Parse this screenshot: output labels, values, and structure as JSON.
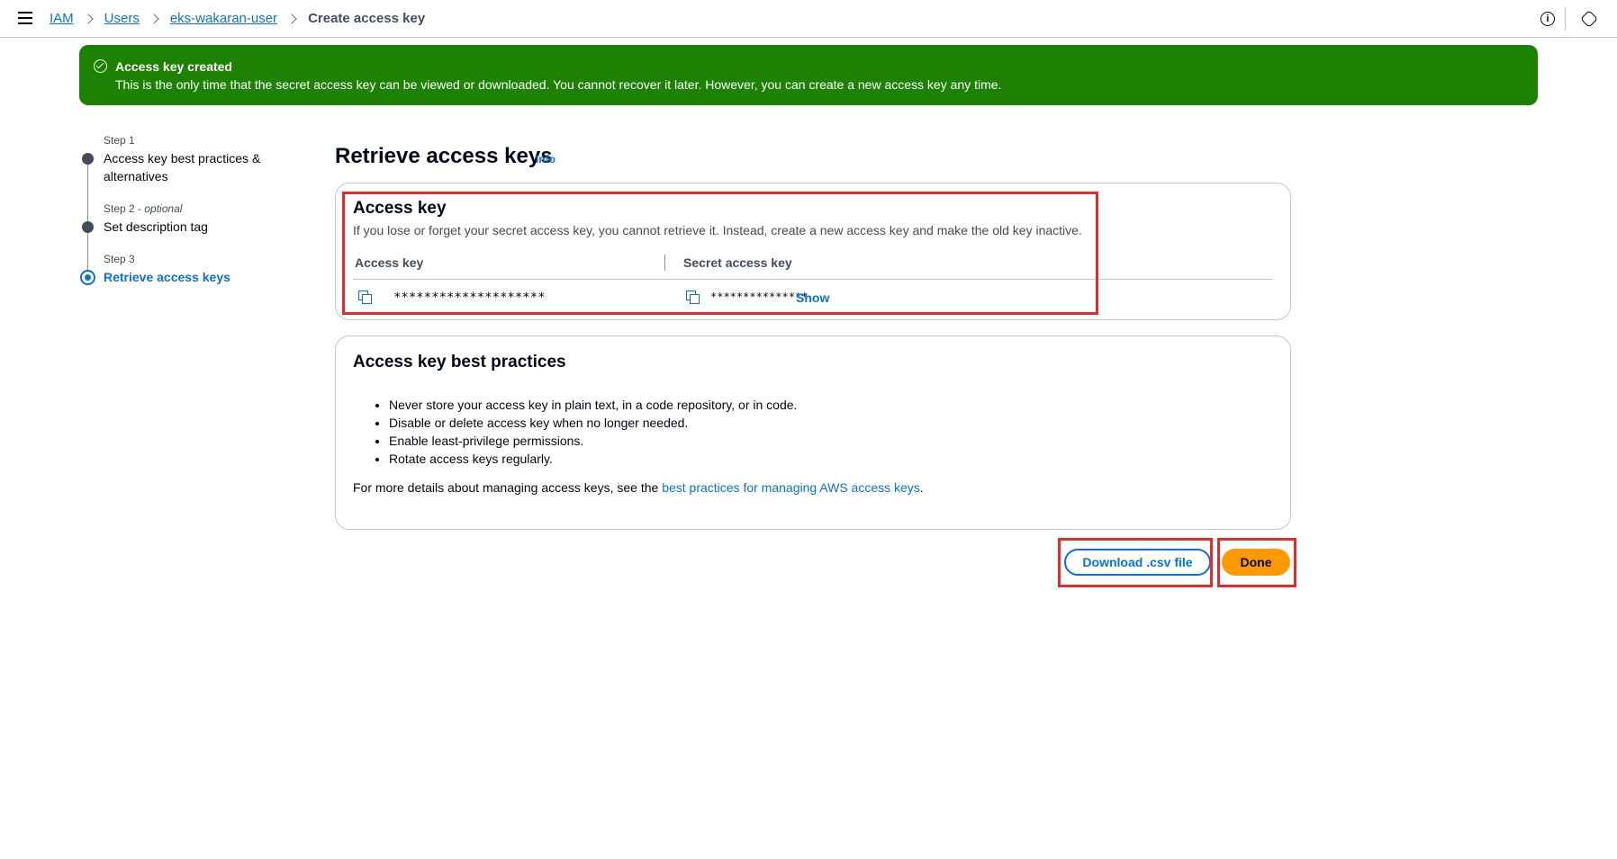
{
  "breadcrumb": {
    "items": [
      "IAM",
      "Users",
      "eks-wakaran-user"
    ],
    "current": "Create access key"
  },
  "topbar": {
    "info_icon": "info-icon",
    "settings_icon": "settings-icon"
  },
  "flash": {
    "title": "Access key created",
    "text": "This is the only time that the secret access key can be viewed or downloaded. You cannot recover it later. However, you can create a new access key any time."
  },
  "steps": [
    {
      "label": "Step 1",
      "title": "Access key best practices & alternatives"
    },
    {
      "label": "Step 2",
      "optional": "optional",
      "title": "Set description tag"
    },
    {
      "label": "Step 3",
      "title": "Retrieve access keys"
    }
  ],
  "main": {
    "title": "Retrieve access keys",
    "info": "Info"
  },
  "access_key_card": {
    "heading": "Access key",
    "description": "If you lose or forget your secret access key, you cannot retrieve it. Instead, create a new access key and make the old key inactive.",
    "col_access_key": "Access key",
    "col_secret_key": "Secret access key",
    "access_key_value": "********************",
    "secret_key_value": "***************",
    "show_label": "Show"
  },
  "best_practices_card": {
    "heading": "Access key best practices",
    "items": [
      "Never store your access key in plain text, in a code repository, or in code.",
      "Disable or delete access key when no longer needed.",
      "Enable least-privilege permissions.",
      "Rotate access keys regularly."
    ],
    "more_prefix": "For more details about managing access keys, see the ",
    "more_link": "best practices for managing AWS access keys",
    "more_suffix": "."
  },
  "actions": {
    "download_label": "Download .csv file",
    "done_label": "Done"
  },
  "colors": {
    "flash_bg": "#1d8102",
    "link": "#0972d3",
    "primary_button": "#ff9900",
    "highlight": "#e22b2b"
  }
}
